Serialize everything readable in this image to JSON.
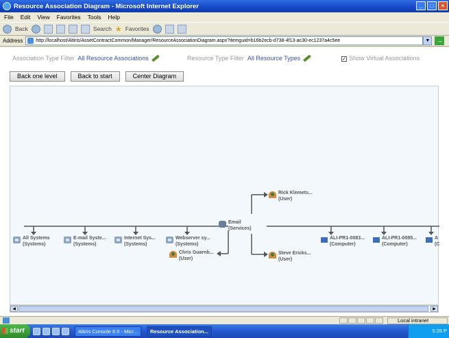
{
  "window": {
    "title": "Resource Association Diagram - Microsoft Internet Explorer"
  },
  "menu": {
    "items": [
      "File",
      "Edit",
      "View",
      "Favorites",
      "Tools",
      "Help"
    ]
  },
  "toolbar": {
    "back_label": "Back",
    "search_label": "Search",
    "favorites_label": "Favorites"
  },
  "address": {
    "label": "Address",
    "url": "http://localhost/Altiris/AssetContractCommon/Manager/ResourceAssociationDiagram.aspx?itemguid=b16b2ecb-d738-4f13-ac30-ec1237a4c5ee",
    "go_label": "Go"
  },
  "filters": {
    "association_label": "Association Type Filter",
    "association_value": "All Resource Associations",
    "resource_label": "Resource Type Filter",
    "resource_value": "All Resource Types",
    "virtual_label": "Show Virtual Associations",
    "virtual_checked": true
  },
  "buttons": {
    "back_level": "Back one level",
    "back_start": "Back to start",
    "center": "Center Diagram"
  },
  "diagram": {
    "center": {
      "name": "Email",
      "type": "(Services)",
      "icon": "service-icon"
    },
    "users": [
      {
        "name": "Rick Klemets...",
        "type": "(User)",
        "icon": "user-icon"
      },
      {
        "name": "Steve Ericks...",
        "type": "(User)",
        "icon": "user-icon"
      },
      {
        "name": "Chris Guarnb...",
        "type": "(User)",
        "icon": "user-icon"
      }
    ],
    "systems": [
      {
        "name": "All Systems",
        "type": "(Systems)",
        "icon": "system-icon"
      },
      {
        "name": "E-mail Syste...",
        "type": "(Systems)",
        "icon": "system-icon"
      },
      {
        "name": "Internet Sys...",
        "type": "(Systems)",
        "icon": "system-icon"
      },
      {
        "name": "Webserver sy...",
        "type": "(Systems)",
        "icon": "system-icon"
      }
    ],
    "computers": [
      {
        "name": "ALI-PR1-0083...",
        "type": "(Computer)",
        "icon": "computer-icon"
      },
      {
        "name": "ALI-PR1-0085...",
        "type": "(Computer)",
        "icon": "computer-icon"
      },
      {
        "name": "A",
        "type": "(C",
        "icon": "computer-icon"
      }
    ],
    "colors": {
      "background": "#f2f8fc",
      "line": "#555555"
    }
  },
  "status": {
    "zone": "Local intranet"
  },
  "taskbar": {
    "start_label": "start",
    "tasks": [
      "Altiris Console 6.5 - Micr...",
      "Resource Association..."
    ],
    "clock": "5:28 P"
  }
}
